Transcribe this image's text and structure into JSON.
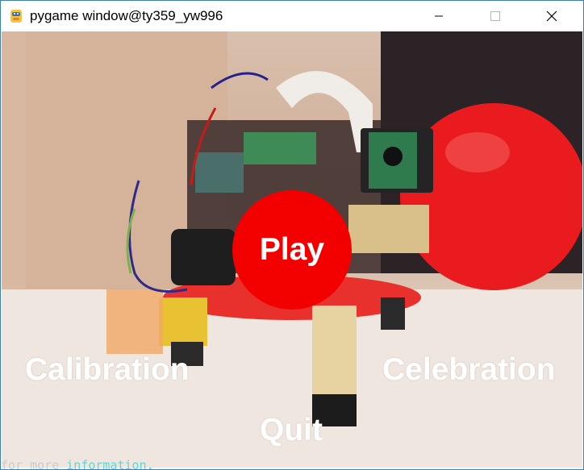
{
  "window": {
    "title": "pygame window@ty359_yw996",
    "icon": "pygame-snake-icon",
    "controls": {
      "minimize_label": "─",
      "maximize_label": "☐",
      "close_label": "✕"
    }
  },
  "menu": {
    "play_label": "Play",
    "calibration_label": "Calibration",
    "celebration_label": "Celebration",
    "quit_label": "Quit"
  },
  "background": {
    "description_icon": "robot-photo-background",
    "play_color": "#f20000"
  },
  "terminal": {
    "prefix": "for more",
    "highlight": "information."
  }
}
